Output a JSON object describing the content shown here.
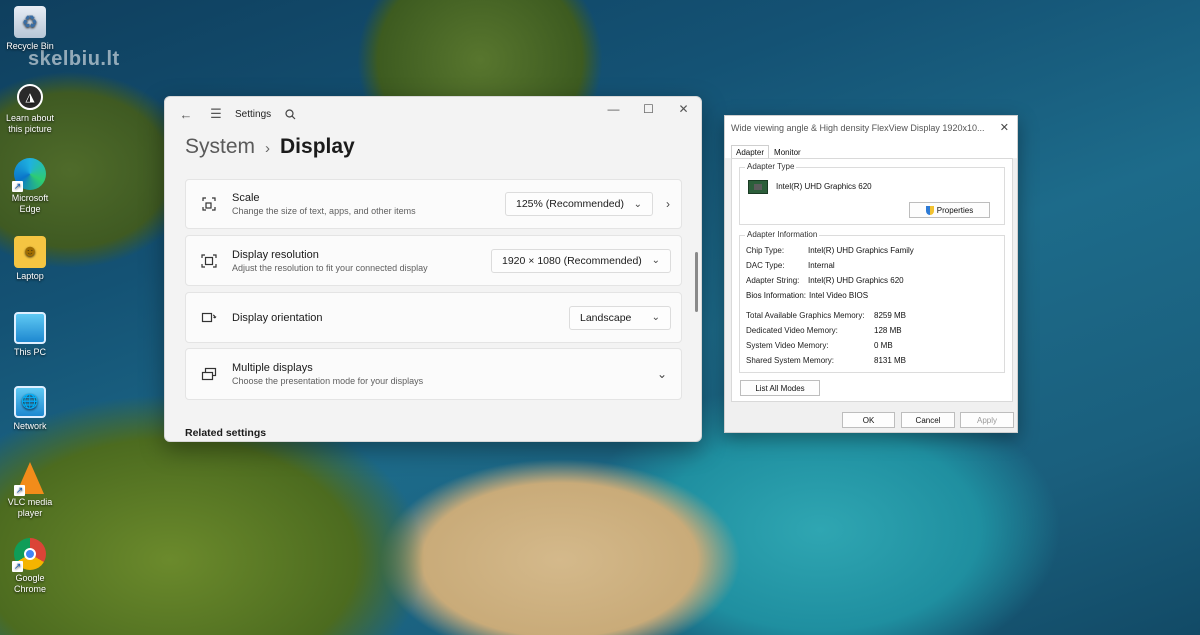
{
  "watermark": "skelbiu.lt",
  "desktop": {
    "icons": [
      {
        "label": "Recycle Bin",
        "icon": "recycle-bin-icon"
      },
      {
        "label": "Learn about\nthis picture",
        "icon": "learn-picture-icon"
      },
      {
        "label": "Microsoft\nEdge",
        "icon": "edge-icon"
      },
      {
        "label": "Laptop",
        "icon": "user-folder-icon"
      },
      {
        "label": "This PC",
        "icon": "monitor-icon"
      },
      {
        "label": "Network",
        "icon": "network-icon"
      },
      {
        "label": "VLC media\nplayer",
        "icon": "vlc-icon"
      },
      {
        "label": "Google\nChrome",
        "icon": "chrome-icon"
      }
    ]
  },
  "settings": {
    "app_title": "Settings",
    "breadcrumb": {
      "parent": "System",
      "separator": "›",
      "current": "Display"
    },
    "cards": {
      "scale": {
        "title": "Scale",
        "subtitle": "Change the size of text, apps, and other items",
        "value": "125% (Recommended)"
      },
      "resolution": {
        "title": "Display resolution",
        "subtitle": "Adjust the resolution to fit your connected display",
        "value": "1920 × 1080 (Recommended)"
      },
      "orientation": {
        "title": "Display orientation",
        "value": "Landscape"
      },
      "multiple": {
        "title": "Multiple displays",
        "subtitle": "Choose the presentation mode for your displays"
      }
    },
    "related_heading": "Related settings"
  },
  "dialog": {
    "title": "Wide viewing angle & High density FlexView Display 1920x10...",
    "tabs": [
      "Adapter",
      "Monitor"
    ],
    "adapter_type": {
      "label": "Adapter Type",
      "value": "Intel(R) UHD Graphics 620",
      "properties_button": "Properties"
    },
    "adapter_info": {
      "label": "Adapter Information",
      "chip_type": {
        "k": "Chip Type:",
        "v": "Intel(R) UHD Graphics Family"
      },
      "dac_type": {
        "k": "DAC Type:",
        "v": "Internal"
      },
      "adapter_string": {
        "k": "Adapter String:",
        "v": "Intel(R) UHD Graphics 620"
      },
      "bios_info": {
        "k": "Bios Information:",
        "v": "Intel Video BIOS"
      },
      "total_mem": {
        "k": "Total Available Graphics Memory:",
        "v": "8259 MB"
      },
      "dedicated_mem": {
        "k": "Dedicated Video Memory:",
        "v": "128 MB"
      },
      "system_mem": {
        "k": "System Video Memory:",
        "v": "0 MB"
      },
      "shared_mem": {
        "k": "Shared System Memory:",
        "v": "8131 MB"
      }
    },
    "list_modes_button": "List All Modes",
    "ok_button": "OK",
    "cancel_button": "Cancel",
    "apply_button": "Apply"
  }
}
